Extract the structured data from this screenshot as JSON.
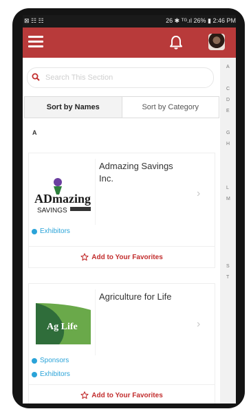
{
  "status_bar": {
    "left": "⊠ ☷ ☷",
    "right": "26 ✱ ᵀᴳ.ıl 26% ▮ 2:46 PM"
  },
  "header": {
    "menu_icon": "hamburger-icon",
    "bell_icon": "bell-icon",
    "avatar": "user-avatar"
  },
  "search": {
    "placeholder": "Search This Section"
  },
  "tabs": [
    {
      "label": "Sort by Names",
      "active": true
    },
    {
      "label": "Sort by Category",
      "active": false
    }
  ],
  "section_letter": "A",
  "exhibitors": [
    {
      "name": "Admazing Savings Inc.",
      "logo_text_main": "ADmazing",
      "logo_text_sub": "SAVINGS",
      "tags": [
        "Exhibitors"
      ],
      "favorite_label": "Add to Your Favorites"
    },
    {
      "name": "Agriculture for Life",
      "logo_text_main": "Ag Life",
      "tags": [
        "Sponsors",
        "Exhibitors"
      ],
      "favorite_label": "Add to Your Favorites"
    }
  ],
  "alpha_index": [
    "A",
    "C",
    "D",
    "E",
    "G",
    "H",
    "L",
    "M",
    "S",
    "T"
  ],
  "colors": {
    "brand": "#b83a3a",
    "tag": "#2aa3d8",
    "favorite": "#c22d2d"
  }
}
